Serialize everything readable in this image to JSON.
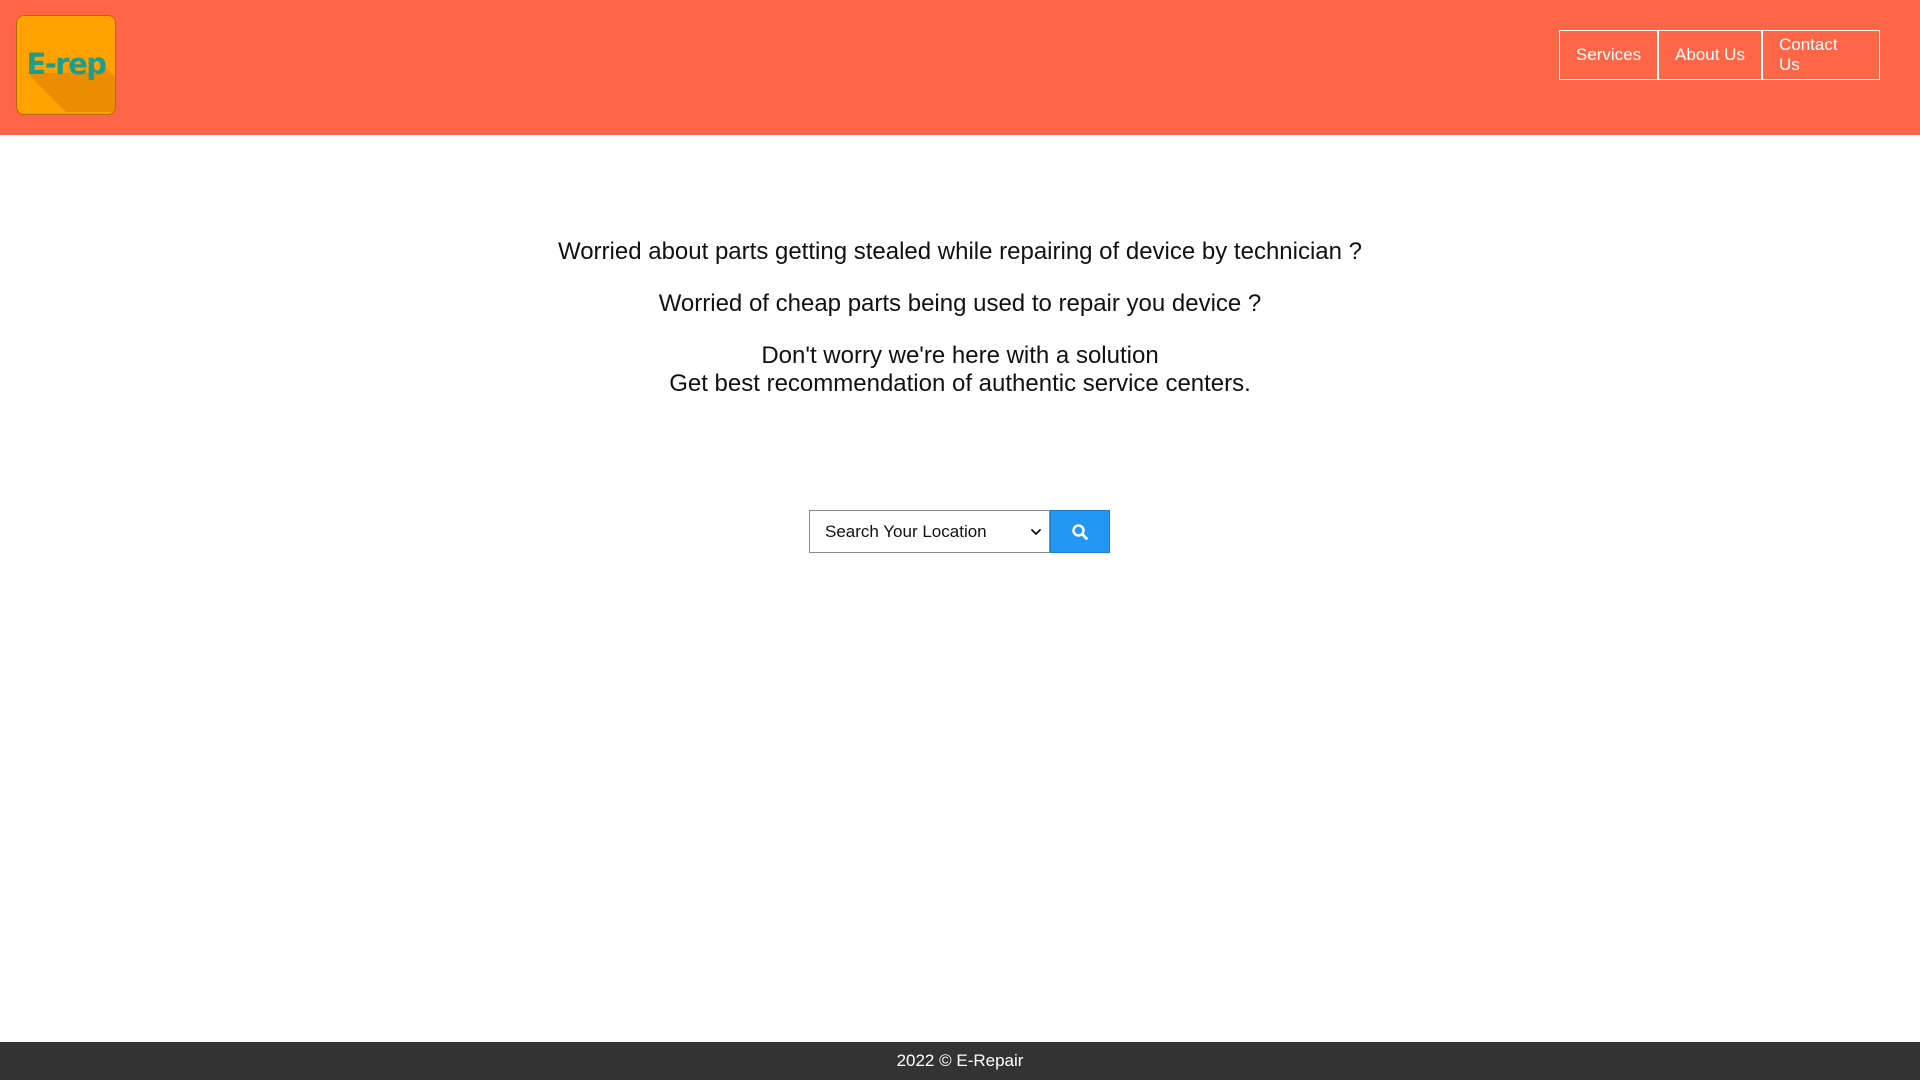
{
  "header": {
    "logo_text": "E-rep",
    "nav": [
      {
        "label": "Services"
      },
      {
        "label": "About Us"
      },
      {
        "label": "Contact Us"
      }
    ],
    "background_color": "#ff6647",
    "logo_color": "#ffa200",
    "logo_text_color": "#1e9c8c"
  },
  "hero": {
    "line1": "Worried about parts getting stealed while repairing of device by technician ?",
    "line2": "Worried of cheap parts being used to repair you device ?",
    "line3": "Don't worry we're here with a solution",
    "line4": "Get best recommendation of authentic service centers."
  },
  "search": {
    "selected_option": "Search Your Location",
    "button_icon": "search-icon",
    "button_color": "#2196f3"
  },
  "footer": {
    "text": "2022 © E-Repair",
    "background_color": "#333333"
  }
}
